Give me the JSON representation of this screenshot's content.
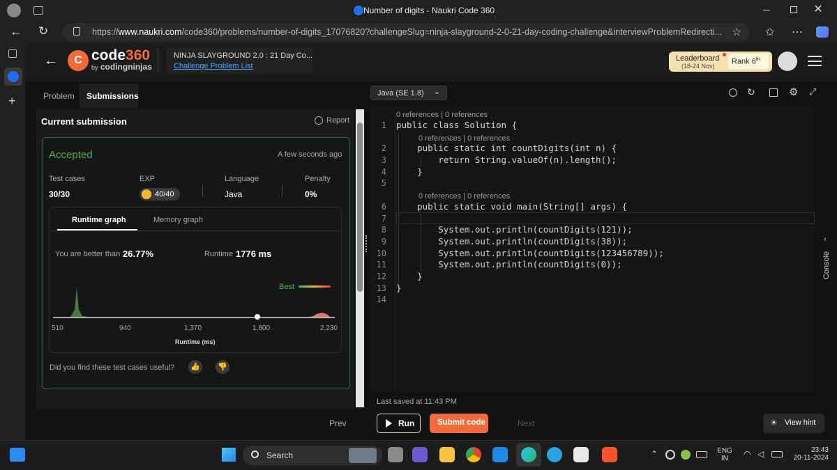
{
  "browser": {
    "tab_title": "Number of digits - Naukri Code 360",
    "url_prefix": "https://",
    "url_domain": "www.naukri.com",
    "url_path": "/code360/problems/number-of-digits_17076820?challengeSlug=ninja-slayground-2-0-21-day-coding-challenge&interviewProblemRedirecti..."
  },
  "header": {
    "logo_code": "code",
    "logo_360": "360",
    "logo_by": "by",
    "logo_cn": "codingninjas",
    "challenge_title": "NINJA SLAYGROUND 2.0 : 21 Day Co...",
    "challenge_link": "Challenge Problem List",
    "leaderboard": "Leaderboard",
    "leaderboard_dates": "(18-24 Nov)",
    "rank_label": "Rank",
    "rank_value": "6",
    "rank_suffix": "th"
  },
  "tabs": {
    "problem": "Problem",
    "submissions": "Submissions"
  },
  "submission": {
    "heading": "Current submission",
    "report": "Report",
    "status": "Accepted",
    "time": "A few seconds ago",
    "test_cases_label": "Test cases",
    "test_cases_value": "30/30",
    "exp_label": "EXP",
    "exp_value": "40/40",
    "language_label": "Language",
    "language_value": "Java",
    "penalty_label": "Penalty",
    "penalty_value": "0%",
    "tab_runtime": "Runtime graph",
    "tab_memory": "Memory graph",
    "better_label": "You are better than",
    "better_value": "26.77%",
    "runtime_label": "Runtime",
    "runtime_value": "1776 ms",
    "best_label": "Best",
    "x_ticks": [
      "510",
      "940",
      "1,370",
      "1,800",
      "2,230"
    ],
    "x_axis": "Runtime (ms)",
    "feedback": "Did you find these test cases useful?"
  },
  "editor": {
    "language": "Java (SE 1.8)",
    "refs": "0 references | 0 references",
    "last_saved": "Last saved at 11:43 PM",
    "console": "Console"
  },
  "code": {
    "lines": [
      "public class Solution {",
      "    public static int countDigits(int n) {",
      "        return String.valueOf(n).length();",
      "    }",
      "",
      "    public static void main(String[] args) {",
      "",
      "        System.out.println(countDigits(121));",
      "        System.out.println(countDigits(38));",
      "        System.out.println(countDigits(123456789));",
      "        System.out.println(countDigits(0));",
      "    }",
      "}",
      ""
    ]
  },
  "bottom": {
    "prev": "Prev",
    "run": "Run",
    "submit": "Submit code",
    "next": "Next",
    "hint": "View hint"
  },
  "taskbar": {
    "search": "Search",
    "lang": "ENG",
    "region": "IN",
    "time": "23:43",
    "date": "20-11-2024"
  },
  "colors": {
    "accent": "#f26b3a",
    "accepted": "#4caf50",
    "link": "#4da3ff"
  }
}
